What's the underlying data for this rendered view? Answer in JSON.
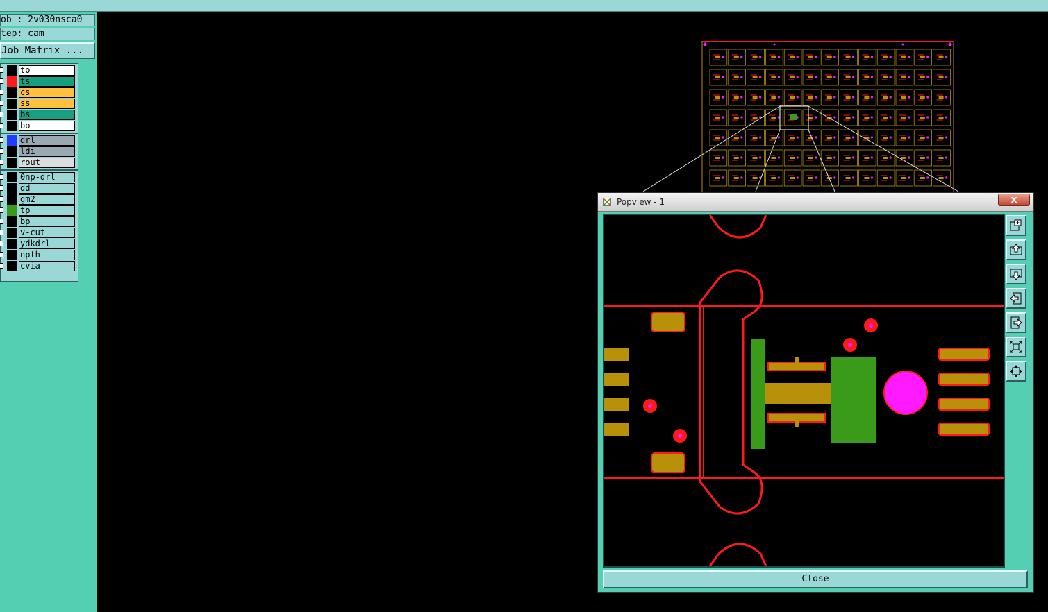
{
  "header": {
    "job_line": "ob : 2v030nsca0",
    "step_line": "tep: cam",
    "job_matrix_label": "Job Matrix ..."
  },
  "layers": [
    {
      "name": "to",
      "color": "#ffffff",
      "swatch": "#000000"
    },
    {
      "name": "ts",
      "color": "#16a080",
      "swatch": "#ff1a1a"
    },
    {
      "name": "cs",
      "color": "#ffc040",
      "swatch": "#000000"
    },
    {
      "name": "ss",
      "color": "#ffc040",
      "swatch": "#000000"
    },
    {
      "name": "bs",
      "color": "#16a080",
      "swatch": "#000000"
    },
    {
      "name": "bo",
      "color": "#ffffff",
      "swatch": "#000000"
    },
    {
      "name": "drl",
      "color": "#9aa8b2",
      "swatch": "#1f3cff"
    },
    {
      "name": "ldi",
      "color": "#9aa8b2",
      "swatch": "#000000"
    },
    {
      "name": "rout",
      "color": "#dcdcdc",
      "swatch": "#000000"
    },
    {
      "name": "0np-drl",
      "color": "#9ad8d8",
      "swatch": "#000000"
    },
    {
      "name": "dd",
      "color": "#9ad8d8",
      "swatch": "#000000"
    },
    {
      "name": "gm2",
      "color": "#9ad8d8",
      "swatch": "#000000"
    },
    {
      "name": "tp",
      "color": "#9ad8d8",
      "swatch": "#3a9a1a"
    },
    {
      "name": "bp",
      "color": "#9ad8d8",
      "swatch": "#000000"
    },
    {
      "name": "v-cut",
      "color": "#9ad8d8",
      "swatch": "#000000"
    },
    {
      "name": "ydkdrl",
      "color": "#9ad8d8",
      "swatch": "#000000"
    },
    {
      "name": "npth",
      "color": "#9ad8d8",
      "swatch": "#000000"
    },
    {
      "name": "cvia",
      "color": "#9ad8d8",
      "swatch": "#000000"
    }
  ],
  "popview": {
    "title": "Popview - 1",
    "close_x": "x",
    "close_button": "Close",
    "tool_icons": [
      "zoom-box-icon",
      "pan-up-icon",
      "pan-down-icon",
      "pan-left-icon",
      "pan-right-icon",
      "zoom-out-icon",
      "zoom-in-icon"
    ]
  },
  "colors": {
    "trace": "#ff1a1a",
    "pad": "#b8900a",
    "copper": "#3a9a1a",
    "via": "#ff1aff",
    "panel": "#55cfb2",
    "field": "#9ad8d8"
  }
}
